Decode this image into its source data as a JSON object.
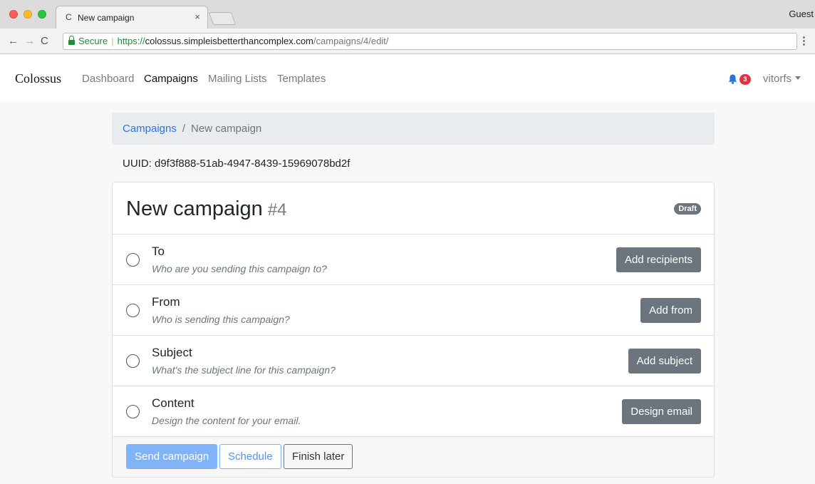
{
  "browser": {
    "tab_title": "New campaign",
    "tab_favicon": "C",
    "tab_close": "×",
    "profile": "Guest",
    "nav": {
      "back": "←",
      "forward": "→",
      "reload": "C"
    },
    "secure_label": "Secure",
    "url": {
      "scheme": "https://",
      "host": "colossus.simpleisbetterthancomplex.com",
      "path": "/campaigns/4/edit/"
    },
    "menu": "⋮"
  },
  "navbar": {
    "brand": "Colossus",
    "links": [
      {
        "label": "Dashboard",
        "active": false
      },
      {
        "label": "Campaigns",
        "active": true
      },
      {
        "label": "Mailing Lists",
        "active": false
      },
      {
        "label": "Templates",
        "active": false
      }
    ],
    "notification_count": "3",
    "username": "vitorfs"
  },
  "breadcrumb": {
    "parent": "Campaigns",
    "separator": "/",
    "current": "New campaign"
  },
  "uuid": "UUID: d9f3f888-51ab-4947-8439-15969078bd2f",
  "campaign": {
    "title": "New campaign",
    "number": "#4",
    "status": "Draft",
    "steps": [
      {
        "title": "To",
        "description": "Who are you sending this campaign to?",
        "button": "Add recipients"
      },
      {
        "title": "From",
        "description": "Who is sending this campaign?",
        "button": "Add from"
      },
      {
        "title": "Subject",
        "description": "What's the subject line for this campaign?",
        "button": "Add subject"
      },
      {
        "title": "Content",
        "description": "Design the content for your email.",
        "button": "Design email"
      }
    ]
  },
  "footer": {
    "send": "Send campaign",
    "schedule": "Schedule",
    "finish": "Finish later"
  },
  "colors": {
    "primary": "#2d74da",
    "primary_disabled": "#80b3f7",
    "secondary": "#6c757d",
    "danger": "#dc3545",
    "secure_green": "#1e8e3e"
  }
}
